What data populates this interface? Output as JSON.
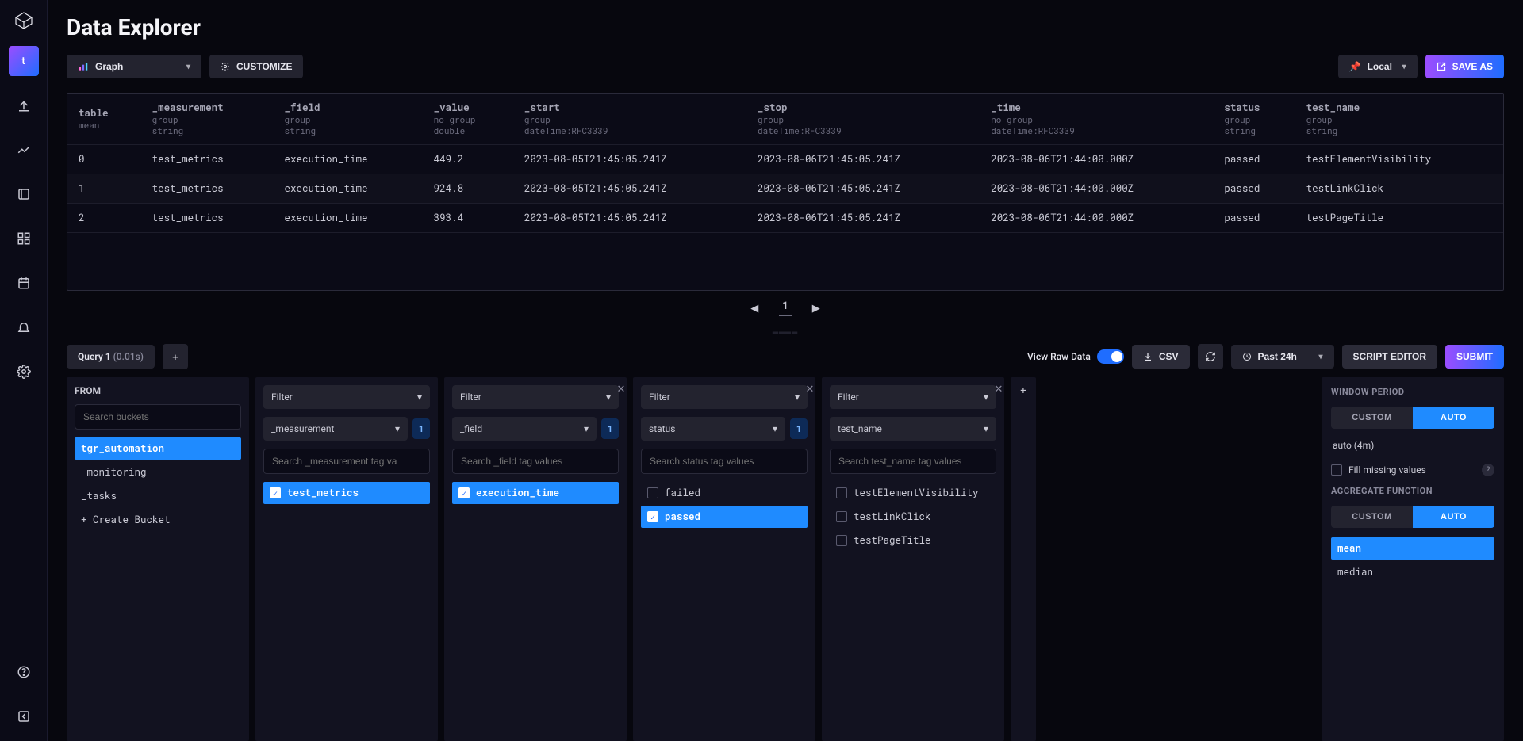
{
  "page_title": "Data Explorer",
  "sidebar": {
    "active_label": "t"
  },
  "toolbar": {
    "view_type": "Graph",
    "customize": "CUSTOMIZE",
    "local": "Local",
    "save_as": "SAVE AS"
  },
  "table": {
    "columns": [
      {
        "name": "table",
        "sub1": "mean",
        "sub2": ""
      },
      {
        "name": "_measurement",
        "sub1": "group",
        "sub2": "string"
      },
      {
        "name": "_field",
        "sub1": "group",
        "sub2": "string"
      },
      {
        "name": "_value",
        "sub1": "no group",
        "sub2": "double"
      },
      {
        "name": "_start",
        "sub1": "group",
        "sub2": "dateTime:RFC3339"
      },
      {
        "name": "_stop",
        "sub1": "group",
        "sub2": "dateTime:RFC3339"
      },
      {
        "name": "_time",
        "sub1": "no group",
        "sub2": "dateTime:RFC3339"
      },
      {
        "name": "status",
        "sub1": "group",
        "sub2": "string"
      },
      {
        "name": "test_name",
        "sub1": "group",
        "sub2": "string"
      }
    ],
    "rows": [
      [
        "0",
        "test_metrics",
        "execution_time",
        "449.2",
        "2023-08-05T21:45:05.241Z",
        "2023-08-06T21:45:05.241Z",
        "2023-08-06T21:44:00.000Z",
        "passed",
        "testElementVisibility"
      ],
      [
        "1",
        "test_metrics",
        "execution_time",
        "924.8",
        "2023-08-05T21:45:05.241Z",
        "2023-08-06T21:45:05.241Z",
        "2023-08-06T21:44:00.000Z",
        "passed",
        "testLinkClick"
      ],
      [
        "2",
        "test_metrics",
        "execution_time",
        "393.4",
        "2023-08-05T21:45:05.241Z",
        "2023-08-06T21:45:05.241Z",
        "2023-08-06T21:44:00.000Z",
        "passed",
        "testPageTitle"
      ]
    ]
  },
  "pager": {
    "page": "1"
  },
  "query_bar": {
    "tab_label": "Query 1",
    "tab_time": "(0.01s)",
    "view_raw": "View Raw Data",
    "csv": "CSV",
    "time_range": "Past 24h",
    "script_editor": "SCRIPT EDITOR",
    "submit": "SUBMIT"
  },
  "from_panel": {
    "title": "FROM",
    "search_placeholder": "Search buckets",
    "buckets": [
      "tgr_automation",
      "_monitoring",
      "_tasks"
    ],
    "selected": "tgr_automation",
    "create": "+ Create Bucket"
  },
  "filters": [
    {
      "title": "Filter",
      "key": "_measurement",
      "badge": "1",
      "search_placeholder": "Search _measurement tag va",
      "options": [
        {
          "label": "test_metrics",
          "selected": true
        }
      ],
      "closable": false
    },
    {
      "title": "Filter",
      "key": "_field",
      "badge": "1",
      "search_placeholder": "Search _field tag values",
      "options": [
        {
          "label": "execution_time",
          "selected": true
        }
      ],
      "closable": true
    },
    {
      "title": "Filter",
      "key": "status",
      "badge": "1",
      "search_placeholder": "Search status tag values",
      "options": [
        {
          "label": "failed",
          "selected": false
        },
        {
          "label": "passed",
          "selected": true
        }
      ],
      "closable": true
    },
    {
      "title": "Filter",
      "key": "test_name",
      "badge": "",
      "search_placeholder": "Search test_name tag values",
      "options": [
        {
          "label": "testElementVisibility",
          "selected": false
        },
        {
          "label": "testLinkClick",
          "selected": false
        },
        {
          "label": "testPageTitle",
          "selected": false
        }
      ],
      "closable": true
    }
  ],
  "right_panel": {
    "window_title": "WINDOW PERIOD",
    "custom": "CUSTOM",
    "auto": "AUTO",
    "auto_value": "auto (4m)",
    "fill_missing": "Fill missing values",
    "agg_title": "AGGREGATE FUNCTION",
    "agg_options": [
      "mean",
      "median"
    ],
    "agg_selected": "mean"
  }
}
